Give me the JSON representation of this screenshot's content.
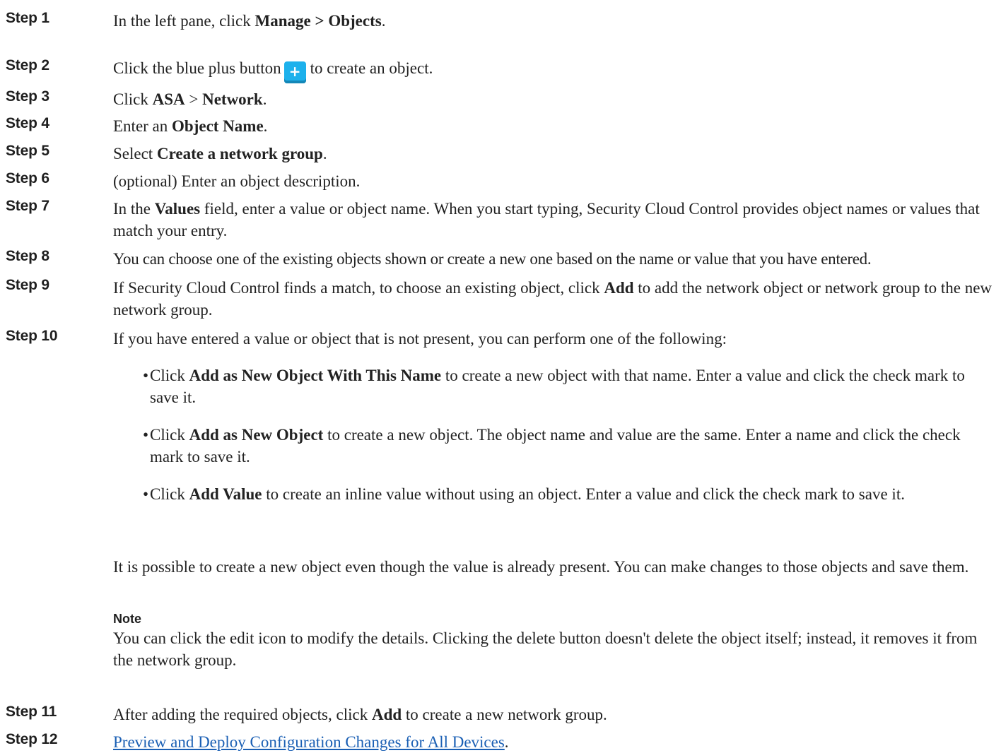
{
  "steps": [
    {
      "label": "Step 1",
      "parts": [
        "In the left pane, click ",
        "Manage > Objects",
        "."
      ]
    },
    {
      "label": "Step 2",
      "before": "Click the blue plus button",
      "after": "to create an object.",
      "icon": "plus-icon"
    },
    {
      "label": "Step 3",
      "parts": [
        "Click ",
        "ASA",
        " > ",
        "Network",
        "."
      ]
    },
    {
      "label": "Step 4",
      "parts": [
        "Enter an ",
        "Object Name",
        "."
      ]
    },
    {
      "label": "Step 5",
      "parts": [
        "Select ",
        "Create a network group",
        "."
      ]
    },
    {
      "label": "Step 6",
      "text": "(optional) Enter an object description."
    },
    {
      "label": "Step 7",
      "parts": [
        "In the ",
        "Values",
        " field, enter a value or object name. When you start typing, Security Cloud Control provides object names or values that match your entry."
      ]
    },
    {
      "label": "Step 8",
      "text": "You can choose one of the existing objects shown or create a new one based on the name or value that you have entered."
    },
    {
      "label": "Step 9",
      "parts": [
        "If Security Cloud Control finds a match, to choose an existing object, click ",
        "Add",
        " to add the network object or network group to the new network group."
      ]
    },
    {
      "label": "Step 10",
      "text": "If you have entered a value or object that is not present, you can perform one of the following:"
    },
    {
      "label": "Step 11",
      "parts": [
        "After adding the required objects, click ",
        "Add",
        " to create a new network group."
      ]
    },
    {
      "label": "Step 12",
      "link": "Preview and Deploy Configuration Changes for All Devices",
      "after": "."
    }
  ],
  "bullets": [
    {
      "parts": [
        "Click ",
        "Add as New Object With This Name",
        " to create a new object with that name. Enter a value and click the check mark to save it."
      ]
    },
    {
      "parts": [
        "Click ",
        "Add as New Object",
        " to create a new object. The object name and value are the same. Enter a name and click the check mark to save it."
      ]
    },
    {
      "parts": [
        "Click ",
        "Add Value",
        " to create an inline value without using an object. Enter a value and click the check mark to save it."
      ]
    }
  ],
  "paragraph": "It is possible to create a new object even though the value is already present. You can make changes to those objects and save them.",
  "note": {
    "label": "Note",
    "text": "You can click the edit icon to modify the details. Clicking the delete button doesn't delete the object itself; instead, it removes it from the network group."
  },
  "colors": {
    "plus_button": "#1db1ec",
    "link": "#1a5fb4"
  }
}
